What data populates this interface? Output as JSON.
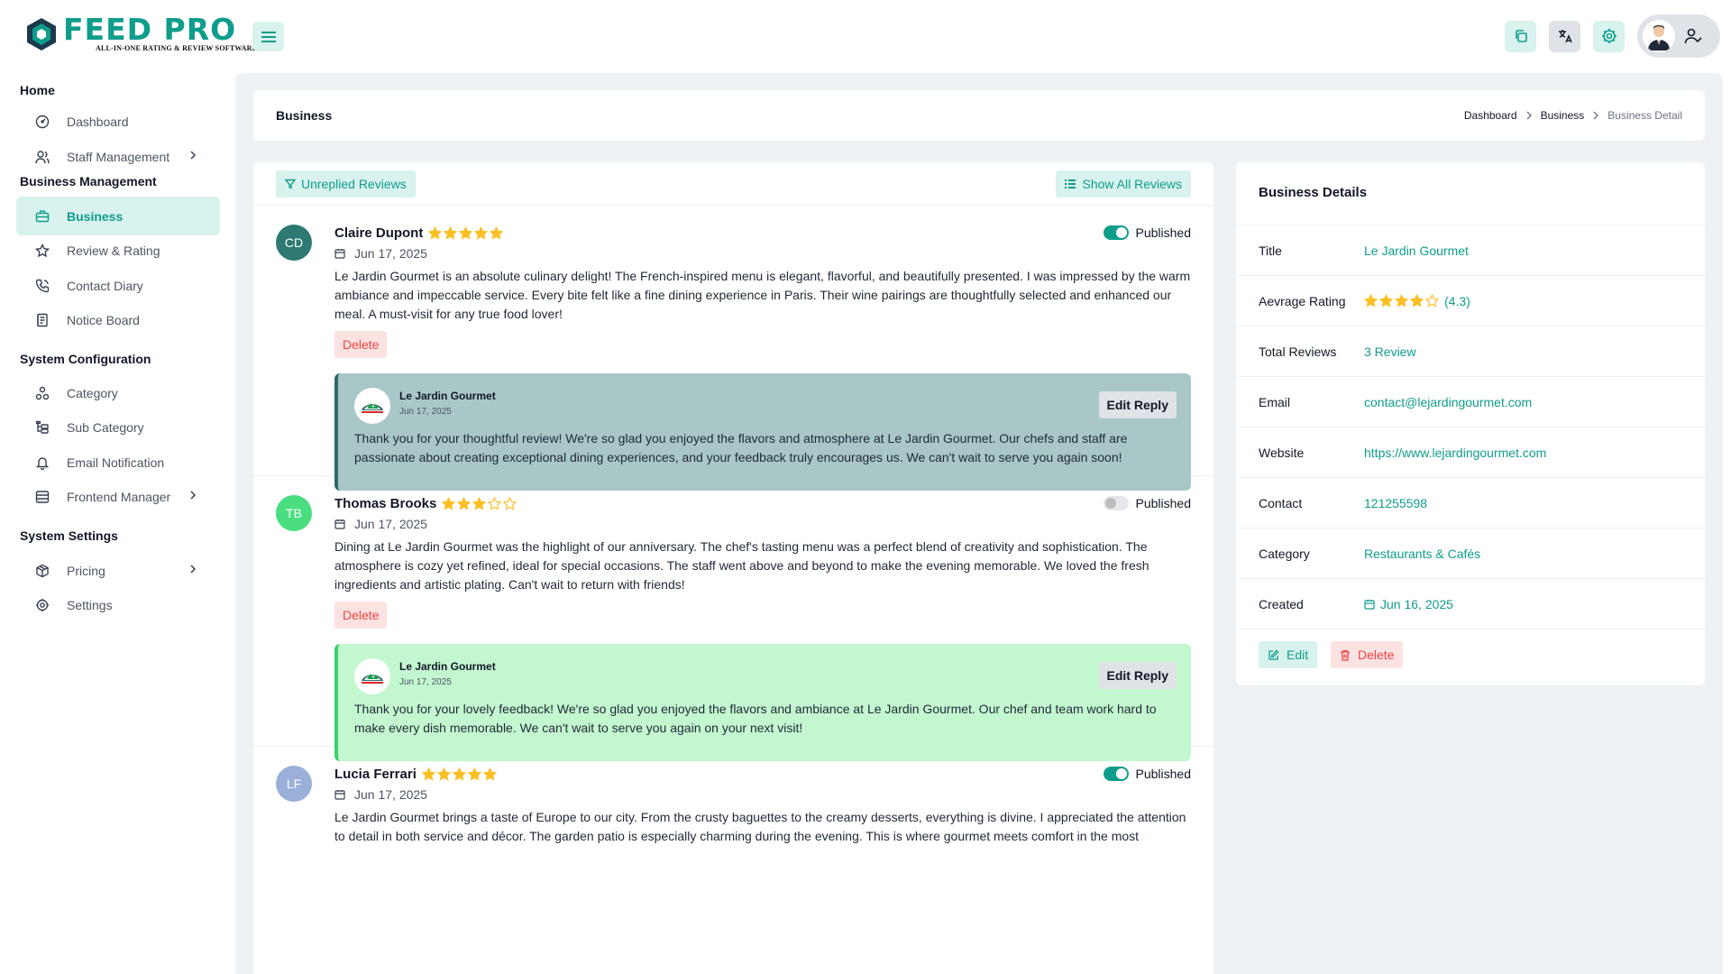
{
  "brand": {
    "title": "FEED PRO",
    "subtitle": "ALL-IN-ONE RATING & REVIEW SOFTWARE",
    "color": "#0f9d8b"
  },
  "sidebar": {
    "sections": [
      {
        "title": "Home"
      },
      {
        "title": "Business Management"
      },
      {
        "title": "System Configuration"
      },
      {
        "title": "System Settings"
      }
    ],
    "items": [
      {
        "label": "Dashboard",
        "icon": "dashboard-icon"
      },
      {
        "label": "Staff Management",
        "icon": "users-icon"
      },
      {
        "label": "Business",
        "icon": "briefcase-icon"
      },
      {
        "label": "Review & Rating",
        "icon": "star-icon"
      },
      {
        "label": "Contact Diary",
        "icon": "phone-icon"
      },
      {
        "label": "Notice Board",
        "icon": "notice-icon"
      },
      {
        "label": "Category",
        "icon": "category-icon"
      },
      {
        "label": "Sub Category",
        "icon": "subcategory-icon"
      },
      {
        "label": "Email Notification",
        "icon": "bell-icon"
      },
      {
        "label": "Frontend Manager",
        "icon": "layout-icon"
      },
      {
        "label": "Pricing",
        "icon": "package-icon"
      },
      {
        "label": "Settings",
        "icon": "gear-icon"
      }
    ]
  },
  "header": {
    "page_title": "Business",
    "breadcrumbs": [
      "Dashboard",
      "Business",
      "Business Detail"
    ]
  },
  "toolbar": {
    "unreplied_label": "Unreplied Reviews",
    "show_all_label": "Show All Reviews"
  },
  "reviews": [
    {
      "initials": "CD",
      "avatar_color": "#2e7a73",
      "name": "Claire Dupont",
      "rating": 5,
      "date": "Jun 17, 2025",
      "published": true,
      "published_label": "Published",
      "text": "Le Jardin Gourmet is an absolute culinary delight! The French-inspired menu is elegant, flavorful, and beautifully presented. I was impressed by the warm ambiance and impeccable service. Every bite felt like a fine dining experience in Paris. Their wine pairings are thoughtfully selected and enhanced our meal. A must-visit for any true food lover!",
      "delete_label": "Delete",
      "reply": {
        "business": "Le Jardin Gourmet",
        "date": "Jun 17, 2025",
        "edit_label": "Edit Reply",
        "text": "Thank you for your thoughtful review! We're so glad you enjoyed the flavors and atmosphere at Le Jardin Gourmet. Our chefs and staff are passionate about creating exceptional dining experiences, and your feedback truly encourages us. We can't wait to serve you again soon!"
      }
    },
    {
      "initials": "TB",
      "avatar_color": "#4ade80",
      "name": "Thomas Brooks",
      "rating": 3,
      "date": "Jun 17, 2025",
      "published": false,
      "published_label": "Published",
      "text": "Dining at Le Jardin Gourmet was the highlight of our anniversary. The chef's tasting menu was a perfect blend of creativity and sophistication. The atmosphere is cozy yet refined, ideal for special occasions. The staff went above and beyond to make the evening memorable. We loved the fresh ingredients and artistic plating. Can't wait to return with friends!",
      "delete_label": "Delete",
      "reply": {
        "business": "Le Jardin Gourmet",
        "date": "Jun 17, 2025",
        "edit_label": "Edit Reply",
        "text": "Thank you for your lovely feedback! We're so glad you enjoyed the flavors and ambiance at Le Jardin Gourmet. Our chef and team work hard to make every dish memorable. We can't wait to serve you again on your next visit!"
      }
    },
    {
      "initials": "LF",
      "avatar_color": "#9bb0d9",
      "name": "Lucia Ferrari",
      "rating": 5,
      "date": "Jun 17, 2025",
      "published": true,
      "published_label": "Published",
      "text": "Le Jardin Gourmet brings a taste of Europe to our city. From the crusty baguettes to the creamy desserts, everything is divine. I appreciated the attention to detail in both service and décor. The garden patio is especially charming during the evening. This is where gourmet meets comfort in the most"
    }
  ],
  "details": {
    "title": "Business Details",
    "rows": [
      {
        "label": "Title",
        "value": "Le Jardin Gourmet"
      },
      {
        "label": "Aevrage Rating",
        "value": "(4.3)",
        "rating": 4
      },
      {
        "label": "Total Reviews",
        "value": "3 Review"
      },
      {
        "label": "Email",
        "value": "contact@lejardingourmet.com"
      },
      {
        "label": "Website",
        "value": "https://www.lejardingourmet.com"
      },
      {
        "label": "Contact",
        "value": "121255598"
      },
      {
        "label": "Category",
        "value": "Restaurants & Cafés"
      },
      {
        "label": "Created",
        "value": "Jun 16, 2025"
      }
    ],
    "edit_label": "Edit",
    "delete_label": "Delete"
  }
}
